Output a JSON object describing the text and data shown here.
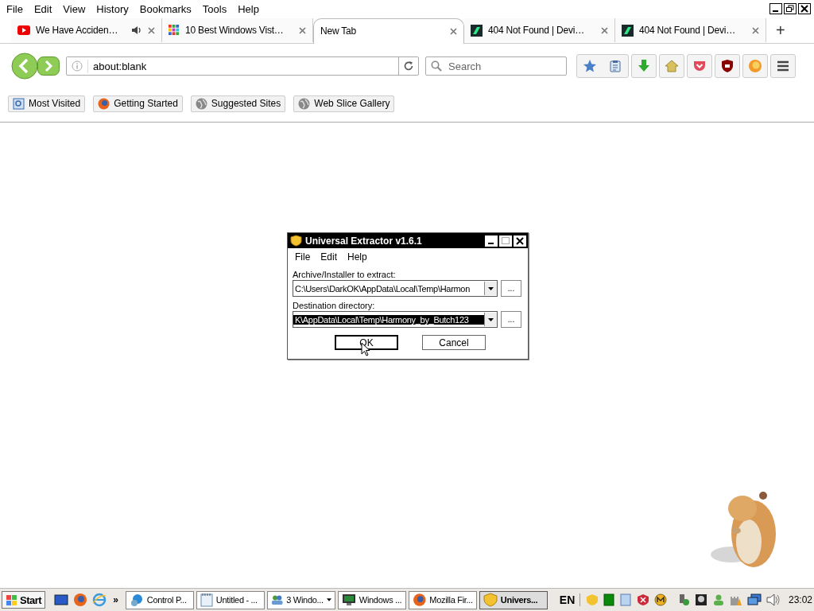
{
  "menu_bar": {
    "items": [
      "File",
      "Edit",
      "View",
      "History",
      "Bookmarks",
      "Tools",
      "Help"
    ]
  },
  "tabs": [
    {
      "title": "We Have Acciden…",
      "selected": false,
      "playing_audio": true
    },
    {
      "title": "10 Best Windows Vist…",
      "selected": false,
      "playing_audio": false
    },
    {
      "title": "New Tab",
      "selected": true,
      "playing_audio": false
    },
    {
      "title": "404 Not Found | Devi…",
      "selected": false,
      "playing_audio": false
    },
    {
      "title": "404 Not Found | Devi…",
      "selected": false,
      "playing_audio": false
    }
  ],
  "new_tab": "+",
  "url_bar": {
    "value": "about:blank"
  },
  "search": {
    "placeholder": "Search"
  },
  "bookmarks": [
    "Most Visited",
    "Getting Started",
    "Suggested Sites",
    "Web Slice Gallery"
  ],
  "dialog": {
    "title": "Universal Extractor v1.6.1",
    "menu": [
      "File",
      "Edit",
      "Help"
    ],
    "fields": [
      {
        "label": "Archive/Installer to extract:",
        "value": "C:\\Users\\DarkOK\\AppData\\Local\\Temp\\Harmon",
        "selected": false,
        "browse": "..."
      },
      {
        "label": "Destination directory:",
        "value": "K\\AppData\\Local\\Temp\\Harmony_by_Butch123",
        "selected": true,
        "browse": "..."
      }
    ],
    "buttons": [
      {
        "label": "OK",
        "default": true
      },
      {
        "label": "Cancel",
        "default": false
      }
    ]
  },
  "taskbar": {
    "start": "Start",
    "more": "»",
    "buttons": [
      {
        "label": "Control P...",
        "selected": false,
        "has_menu": false
      },
      {
        "label": "Untitled - ...",
        "selected": false,
        "has_menu": false
      },
      {
        "label": "3 Windo...",
        "selected": false,
        "has_menu": true
      },
      {
        "label": "Windows ...",
        "selected": false,
        "has_menu": false
      },
      {
        "label": "Mozilla Fir...",
        "selected": false,
        "has_menu": false
      },
      {
        "label": "Univers...",
        "selected": true,
        "has_menu": false
      }
    ],
    "language": "EN",
    "clock": "23:02"
  }
}
